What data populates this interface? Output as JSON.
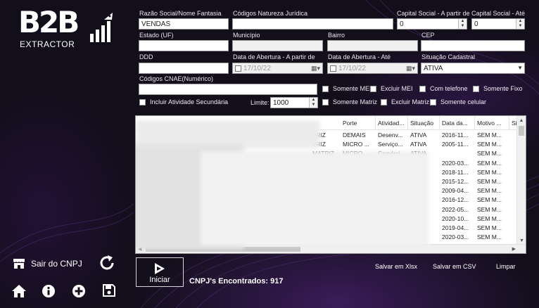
{
  "app": {
    "logo_text": "B2B",
    "logo_sub": "EXTRACTOR"
  },
  "form": {
    "razao_label": "Razão Social/Nome Fantasia",
    "razao_value": "VENDAS",
    "natureza_label": "Códigos Natureza Jurídica",
    "natureza_value": "",
    "capital_min_label": "Capital Social - A partir de",
    "capital_min_value": "0",
    "capital_max_label": "Capital Social - Até",
    "capital_max_value": "0",
    "estado_label": "Estado (UF)",
    "municipio_label": "Município",
    "bairro_label": "Bairro",
    "cep_label": "CEP",
    "ddd_label": "DDD",
    "abertura_min_label": "Data de Abertura - A partir de",
    "abertura_min_value": "17/10/22",
    "abertura_max_label": "Data de Abertura - Até",
    "abertura_max_value": "17/10/22",
    "situacao_label": "Situação Cadastral",
    "situacao_value": "ATIVA",
    "cnae_label": "Códigos CNAE(Numérico)",
    "cnae_value": "",
    "limite_label": "Limite:",
    "limite_value": "1000"
  },
  "checkboxes": {
    "somente_mei": "Somente MEI",
    "excluir_mei": "Excluir MEI",
    "com_telefone": "Com telefone",
    "somente_fixo": "Somente Fixo",
    "incluir_secundaria": "Incluir Atividade Secundária",
    "somente_matriz": "Somente Matriz",
    "excluir_matriz": "Excluir Matriz",
    "somente_celular": "Somente celular"
  },
  "table": {
    "headers": [
      "Porte",
      "Atividad...",
      "Situação",
      "Data da...",
      "Motivo ...",
      "Si"
    ],
    "rows": [
      {
        "tipo": "TRIZ",
        "porte": "DEMAIS",
        "atividade": "Desenv...",
        "situacao": "ATIVA",
        "data": "2016-11...",
        "motivo": "SEM M..."
      },
      {
        "tipo": "TRIZ",
        "porte": "MICRO ...",
        "atividade": "Serviço...",
        "situacao": "ATIVA",
        "data": "2005-11...",
        "motivo": "SEM M..."
      },
      {
        "tipo": "MATRIZ",
        "porte": "MICRO ...",
        "atividade": "Comérci...",
        "situacao": "ATIVA",
        "data": "",
        "motivo": "SEM M..."
      },
      {
        "tipo": "",
        "porte": "",
        "atividade": "",
        "situacao": "",
        "data": "2020-03...",
        "motivo": "SEM M..."
      },
      {
        "tipo": "",
        "porte": "",
        "atividade": "",
        "situacao": "",
        "data": "2018-11...",
        "motivo": "SEM M..."
      },
      {
        "tipo": "",
        "porte": "",
        "atividade": "",
        "situacao": "",
        "data": "2015-12...",
        "motivo": "SEM M..."
      },
      {
        "tipo": "",
        "porte": "",
        "atividade": "",
        "situacao": "",
        "data": "2009-04...",
        "motivo": "SEM M..."
      },
      {
        "tipo": "",
        "porte": "",
        "atividade": "",
        "situacao": "",
        "data": "2016-12...",
        "motivo": "SEM M..."
      },
      {
        "tipo": "",
        "porte": "",
        "atividade": "",
        "situacao": "",
        "data": "2022-05...",
        "motivo": "SEM M..."
      },
      {
        "tipo": "",
        "porte": "",
        "atividade": "",
        "situacao": "",
        "data": "2020-10...",
        "motivo": "SEM M..."
      },
      {
        "tipo": "",
        "porte": "",
        "atividade": "",
        "situacao": "",
        "data": "2019-04...",
        "motivo": "SEM M..."
      },
      {
        "tipo": "",
        "porte": "",
        "atividade": "",
        "situacao": "",
        "data": "2020-03...",
        "motivo": "SEM M..."
      }
    ]
  },
  "actions": {
    "iniciar": "Iniciar",
    "found": "CNPJ's Encontrados: 917",
    "salvar_xlsx": "Salvar em Xlsx",
    "salvar_csv": "Salvar em CSV",
    "limpar": "Limpar"
  },
  "sidebar": {
    "sair_label": "Sair do CNPJ"
  },
  "icons": {
    "logout": "store-exit-icon",
    "refresh": "refresh-icon",
    "home": "home-icon",
    "info": "info-icon",
    "add": "plus-circle-icon",
    "save": "save-icon",
    "play": "play-icon",
    "rocket": "rocket-icon"
  },
  "colors": {
    "background": "#14101c",
    "accent_purple": "#5a288c"
  }
}
